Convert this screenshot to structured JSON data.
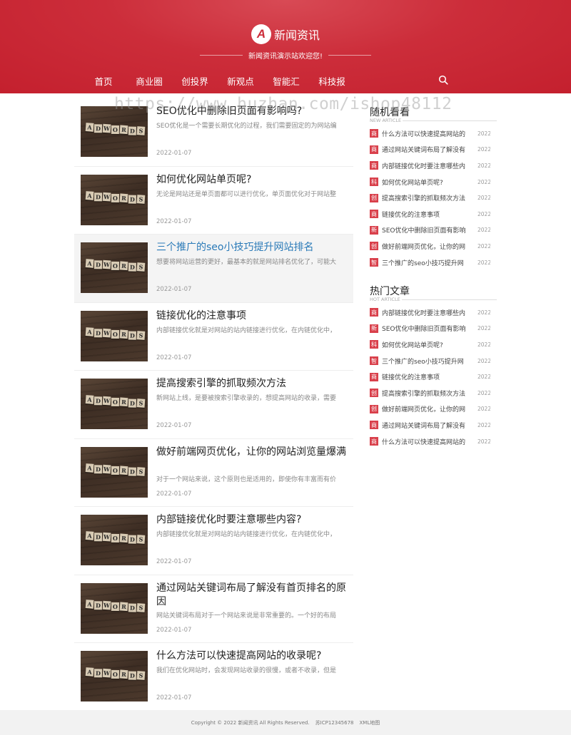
{
  "site": {
    "logo_letter": "A",
    "name": "新闻资讯",
    "tagline": "新闻资讯演示站欢迎您!"
  },
  "nav": [
    "首页",
    "商业圈",
    "创投界",
    "新观点",
    "智能汇",
    "科技报"
  ],
  "watermark": "https://www.huzhan.com/ishop48112",
  "thumbnail_tiles": [
    "A",
    "D",
    "W",
    "O",
    "R",
    "D",
    "S"
  ],
  "articles": [
    {
      "title": "SEO优化中删除旧页面有影响吗?",
      "excerpt": "SEO优化是一个需要长期优化的过程，我们需要固定的为网站编",
      "date": "2022-01-07"
    },
    {
      "title": "如何优化网站单页呢?",
      "excerpt": "无论是网站还是单页面都可以进行优化，单页面优化对于网站整",
      "date": "2022-01-07"
    },
    {
      "title": "三个推广的seo小技巧提升网站排名",
      "excerpt": "想要将网站运营的更好，最基本的就是网站排名优化了，可能大",
      "date": "2022-01-07"
    },
    {
      "title": "链接优化的注意事项",
      "excerpt": "内部链接优化就是对网站的站内链接进行优化，在内链优化中，",
      "date": "2022-01-07"
    },
    {
      "title": "提高搜索引擎的抓取频次方法",
      "excerpt": "新网站上线，是要被搜索引擎收录的，想提高网站的收录，需要",
      "date": "2022-01-07"
    },
    {
      "title": "做好前端网页优化，让你的网站浏览量爆满",
      "excerpt": "对于一个网站来说，这个原则也是适用的，即使你有丰富而有价",
      "date": "2022-01-07"
    },
    {
      "title": "内部链接优化时要注意哪些内容?",
      "excerpt": "内部链接优化就是对网站的站内链接进行优化，在内链优化中，",
      "date": "2022-01-07"
    },
    {
      "title": "通过网站关键词布局了解没有首页排名的原因",
      "excerpt": "网站关键词布局对于一个网站来说是非常重要的。一个好的布局",
      "date": "2022-01-07"
    },
    {
      "title": "什么方法可以快速提高网站的收录呢?",
      "excerpt": "我们在优化网站时，会发现网站收录的很慢，或者不收录，但是",
      "date": "2022-01-07"
    }
  ],
  "sidebar": {
    "random": {
      "title": "随机看看",
      "subtitle": "NEW ARTICLE",
      "items": [
        {
          "badge": "商",
          "text": "什么方法可以快速提高网站的",
          "date": "2022-"
        },
        {
          "badge": "商",
          "text": "通过网站关键词布局了解没有",
          "date": "2022-"
        },
        {
          "badge": "商",
          "text": "内部链接优化时要注意哪些内",
          "date": "2022-"
        },
        {
          "badge": "科",
          "text": "如何优化网站单页呢?",
          "date": "2022-"
        },
        {
          "badge": "创",
          "text": "提高搜索引擎的抓取频次方法",
          "date": "2022-"
        },
        {
          "badge": "商",
          "text": "链接优化的注意事项",
          "date": "2022-"
        },
        {
          "badge": "新",
          "text": "SEO优化中删除旧页面有影响",
          "date": "2022-"
        },
        {
          "badge": "创",
          "text": "做好前端网页优化，让你的网",
          "date": "2022-"
        },
        {
          "badge": "智",
          "text": "三个推广的seo小技巧提升网",
          "date": "2022-"
        }
      ]
    },
    "hot": {
      "title": "热门文章",
      "subtitle": "HOT ARTICLE",
      "items": [
        {
          "badge": "商",
          "text": "内部链接优化时要注意哪些内",
          "date": "2022-"
        },
        {
          "badge": "新",
          "text": "SEO优化中删除旧页面有影响",
          "date": "2022-"
        },
        {
          "badge": "科",
          "text": "如何优化网站单页呢?",
          "date": "2022-"
        },
        {
          "badge": "智",
          "text": "三个推广的seo小技巧提升网",
          "date": "2022-"
        },
        {
          "badge": "商",
          "text": "链接优化的注意事项",
          "date": "2022-"
        },
        {
          "badge": "创",
          "text": "提高搜索引擎的抓取频次方法",
          "date": "2022-"
        },
        {
          "badge": "创",
          "text": "做好前端网页优化，让你的网",
          "date": "2022-"
        },
        {
          "badge": "商",
          "text": "通过网站关键词布局了解没有",
          "date": "2022-"
        },
        {
          "badge": "商",
          "text": "什么方法可以快速提高网站的",
          "date": "2022-"
        }
      ]
    }
  },
  "footer": {
    "copyright": "Copyright © 2022 新闻资讯 All Rights Reserved.",
    "icp": "苏ICP12345678",
    "sitemap": "XML地图"
  },
  "colors": {
    "brand_red": "#cc2d3a",
    "badge_red": "#d9404b",
    "active_link": "#2a7ab8"
  },
  "icons": {
    "search": "search-icon",
    "logo": "logo-icon"
  }
}
